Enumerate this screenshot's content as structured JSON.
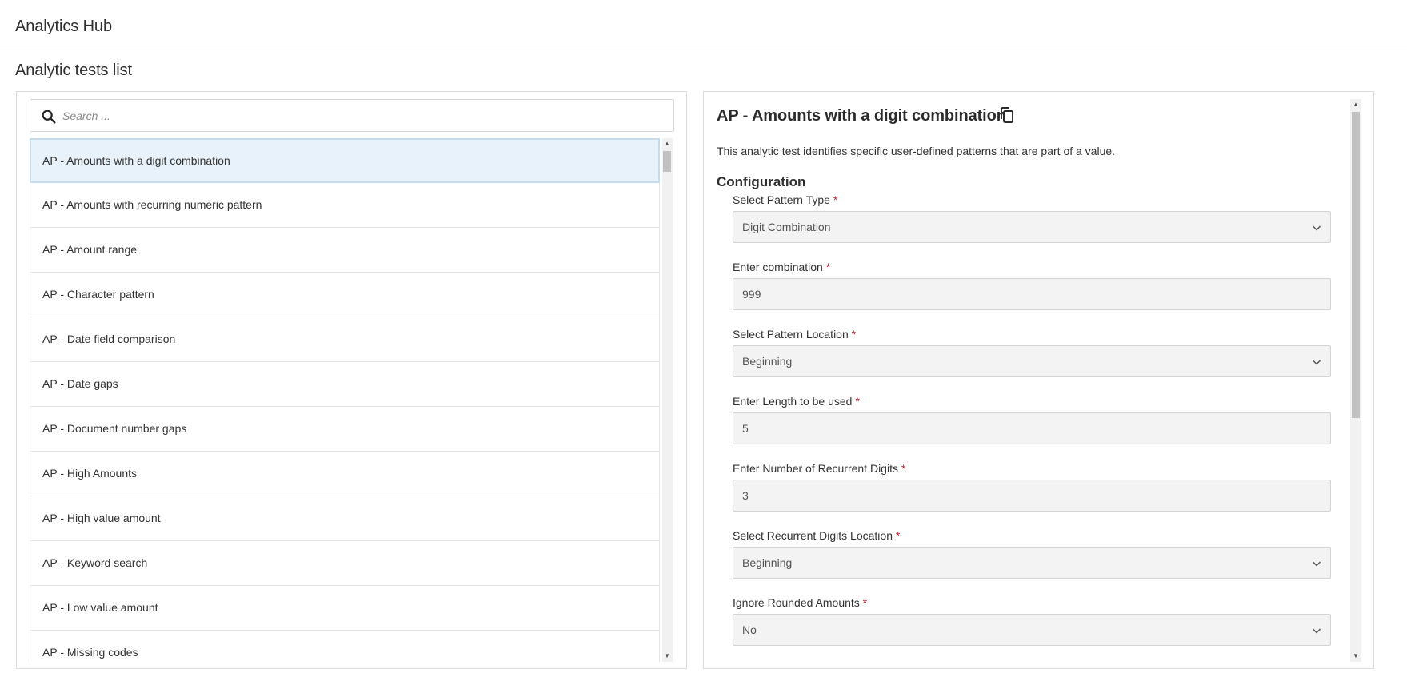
{
  "app": {
    "title": "Analytics Hub"
  },
  "page": {
    "title": "Analytic tests list"
  },
  "search": {
    "placeholder": "Search ..."
  },
  "tests": [
    "AP - Amounts with a digit combination",
    "AP - Amounts with recurring numeric pattern",
    "AP - Amount range",
    "AP - Character pattern",
    "AP - Date field comparison",
    "AP - Date gaps",
    "AP - Document number gaps",
    "AP - High Amounts",
    "AP - High value amount",
    "AP - Keyword search",
    "AP - Low value amount",
    "AP - Missing codes"
  ],
  "selected_test_index": 0,
  "detail": {
    "title": "AP - Amounts with a digit combination",
    "description": "This analytic test identifies specific user-defined patterns that are part of a value.",
    "config_heading": "Configuration",
    "required_marker": "*",
    "fields": [
      {
        "label": "Select Pattern Type",
        "type": "select",
        "value": "Digit Combination"
      },
      {
        "label": "Enter combination",
        "type": "input",
        "value": "999"
      },
      {
        "label": "Select Pattern Location",
        "type": "select",
        "value": "Beginning"
      },
      {
        "label": "Enter Length to be used",
        "type": "input",
        "value": "5"
      },
      {
        "label": "Enter Number of Recurrent Digits",
        "type": "input",
        "value": "3"
      },
      {
        "label": "Select Recurrent Digits Location",
        "type": "select",
        "value": "Beginning"
      },
      {
        "label": "Ignore Rounded Amounts",
        "type": "select",
        "value": "No"
      }
    ]
  },
  "icons": {
    "search": "search-icon",
    "copy": "copy-icon",
    "dropdown": "chevron-down-icon"
  },
  "colors": {
    "selected_bg": "#e8f2fa",
    "selected_border": "#c6ddef",
    "required": "#c4262e",
    "field_bg": "#f3f3f3"
  }
}
